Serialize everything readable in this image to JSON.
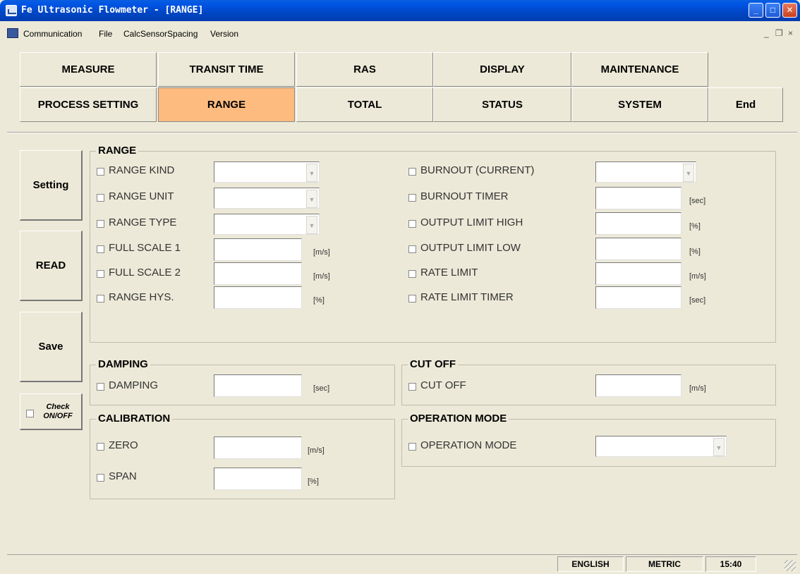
{
  "window": {
    "title": "Fe Ultrasonic Flowmeter - [RANGE]",
    "controls": {
      "minimize": "_",
      "maximize": "□",
      "close": "✕"
    }
  },
  "menu": {
    "items": [
      "Communication",
      "File",
      "CalcSensorSpacing",
      "Version"
    ],
    "mdi_controls": {
      "minimize": "_",
      "restore": "❐",
      "close": "×"
    }
  },
  "tabs": {
    "row1": [
      "MEASURE",
      "TRANSIT TIME",
      "RAS",
      "DISPLAY",
      "MAINTENANCE"
    ],
    "row2": [
      "PROCESS SETTING",
      "RANGE",
      "TOTAL",
      "STATUS",
      "SYSTEM",
      "End"
    ],
    "active": "RANGE"
  },
  "colors": {
    "active_tab": "#fdbb80",
    "background": "#ece9d8",
    "titlebar": "#0055e5"
  },
  "side": {
    "setting": "Setting",
    "read": "READ",
    "save": "Save",
    "check_line1": "Check",
    "check_line2": "ON/OFF"
  },
  "groups": {
    "range": {
      "title": "RANGE",
      "left": [
        {
          "label": "RANGE KIND",
          "type": "select",
          "value": ""
        },
        {
          "label": "RANGE UNIT",
          "type": "select",
          "value": ""
        },
        {
          "label": "RANGE TYPE",
          "type": "select",
          "value": ""
        },
        {
          "label": "FULL SCALE 1",
          "type": "input",
          "value": "",
          "unit": "[m/s]"
        },
        {
          "label": "FULL SCALE 2",
          "type": "input",
          "value": "",
          "unit": "[m/s]"
        },
        {
          "label": "RANGE  HYS.",
          "type": "input",
          "value": "",
          "unit": "[%]"
        }
      ],
      "right": [
        {
          "label": "BURNOUT (CURRENT)",
          "type": "select",
          "value": ""
        },
        {
          "label": "BURNOUT TIMER",
          "type": "input",
          "value": "",
          "unit": "[sec]"
        },
        {
          "label": "OUTPUT LIMIT HIGH",
          "type": "input",
          "value": "",
          "unit": "[%]"
        },
        {
          "label": "OUTPUT LIMIT LOW",
          "type": "input",
          "value": "",
          "unit": "[%]"
        },
        {
          "label": "RATE LIMIT",
          "type": "input",
          "value": "",
          "unit": "[m/s]"
        },
        {
          "label": "RATE LIMIT TIMER",
          "type": "input",
          "value": "",
          "unit": "[sec]"
        }
      ]
    },
    "damping": {
      "title": "DAMPING",
      "label": "DAMPING",
      "value": "",
      "unit": "[sec]"
    },
    "cutoff": {
      "title": "CUT OFF",
      "label": "CUT OFF",
      "value": "",
      "unit": "[m/s]"
    },
    "calibration": {
      "title": "CALIBRATION",
      "zero": {
        "label": "ZERO",
        "value": "",
        "unit": "[m/s]"
      },
      "span": {
        "label": "SPAN",
        "value": "",
        "unit": "[%]"
      }
    },
    "operation": {
      "title": "OPERATION MODE",
      "label": "OPERATION MODE",
      "value": ""
    }
  },
  "status": {
    "language": "ENGLISH",
    "units": "METRIC",
    "time": "15:40"
  },
  "icons": {
    "dropdown": "▼"
  }
}
